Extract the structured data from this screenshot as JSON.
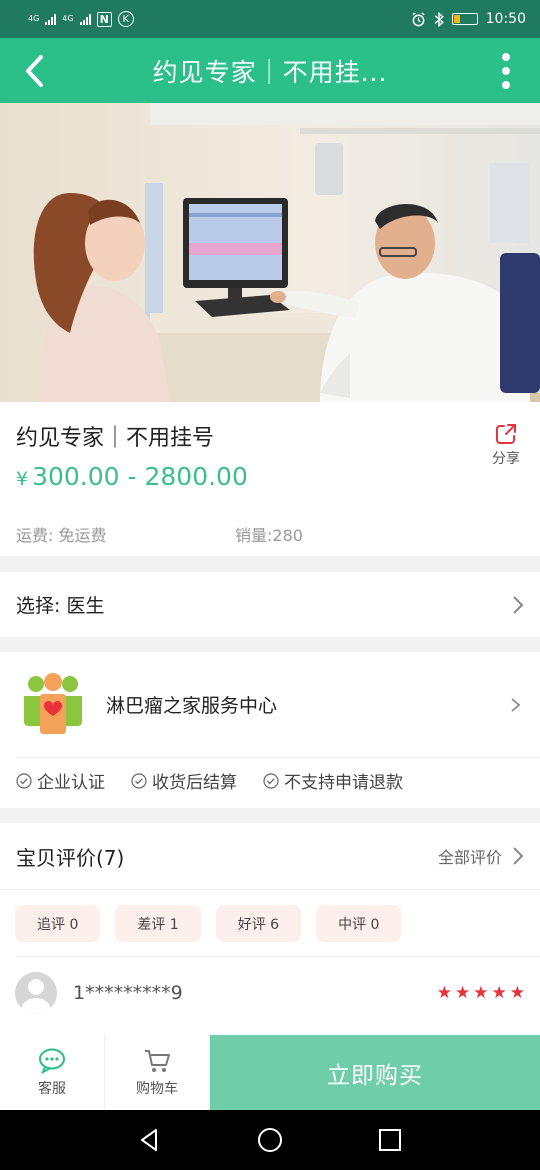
{
  "status_bar": {
    "net1": "4G",
    "net2": "4G",
    "nfc": "N",
    "k": "K",
    "time": "10:50",
    "battery_level": 0.3
  },
  "header": {
    "title": "约见专家｜不用挂..."
  },
  "product": {
    "title": "约见专家｜不用挂号",
    "price_symbol": "¥",
    "price": "300.00 - 2800.00",
    "shipping": "运费: 免运费",
    "sales": "销量:280",
    "share_label": "分享"
  },
  "choose": {
    "label": "选择: 医生"
  },
  "shop": {
    "name": "淋巴瘤之家服务中心",
    "badges": [
      "企业认证",
      "收货后结算",
      "不支持申请退款"
    ]
  },
  "reviews": {
    "title": "宝贝评价(7)",
    "all_label": "全部评价",
    "tags": [
      "追评 0",
      "差评 1",
      "好评 6",
      "中评 0"
    ],
    "first_review": {
      "user": "1*********9",
      "rating": 5
    }
  },
  "bottom_bar": {
    "service_label": "客服",
    "cart_label": "购物车",
    "buy_label": "立即购买"
  },
  "colors": {
    "accent": "#2bbf8a",
    "price": "#3cbf8f",
    "buy": "#6fcdaa",
    "share": "#e8323c",
    "stars": "#e8323c"
  }
}
